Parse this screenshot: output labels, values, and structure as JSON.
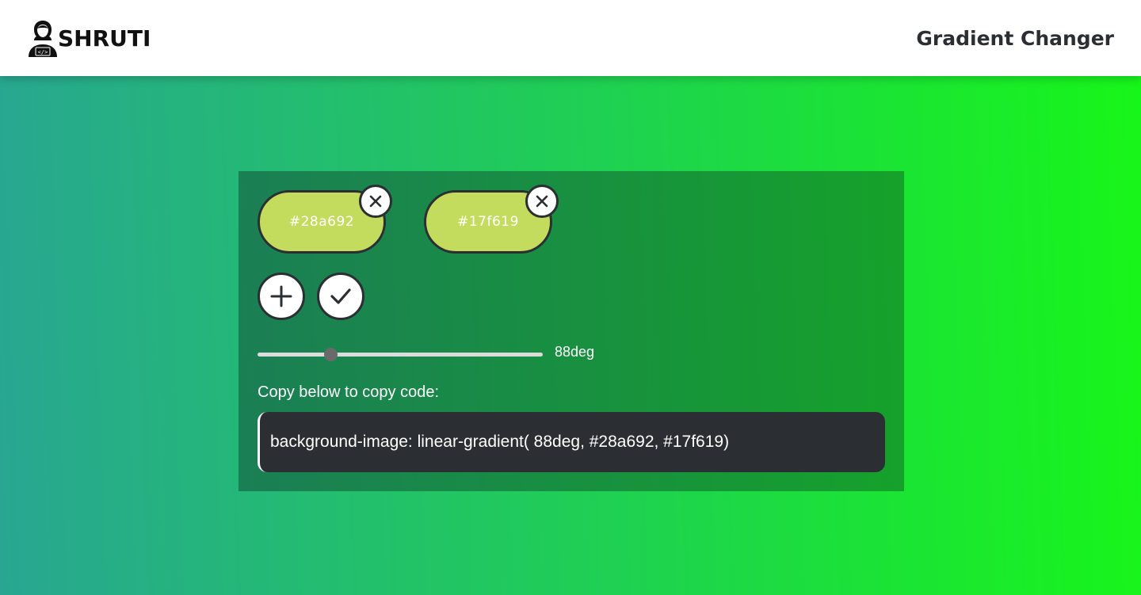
{
  "header": {
    "brand_name": "SHRUTI",
    "brand_icon": "coder-avatar-icon",
    "title": "Gradient Changer"
  },
  "colors": {
    "gradient_start": "#28a692",
    "gradient_end": "#17f619",
    "chip_fill": "#c3dc5e",
    "dark": "#2b2f33"
  },
  "gradient": {
    "colors": [
      "#28a692",
      "#17f619"
    ],
    "angle_label": "88deg",
    "angle_value": 88,
    "angle_max": 360
  },
  "actions": {
    "add_icon": "plus-icon",
    "apply_icon": "check-icon",
    "remove_icon": "close-icon"
  },
  "copy": {
    "label": "Copy below to copy code:",
    "code": "background-image: linear-gradient( 88deg, #28a692, #17f619)"
  }
}
